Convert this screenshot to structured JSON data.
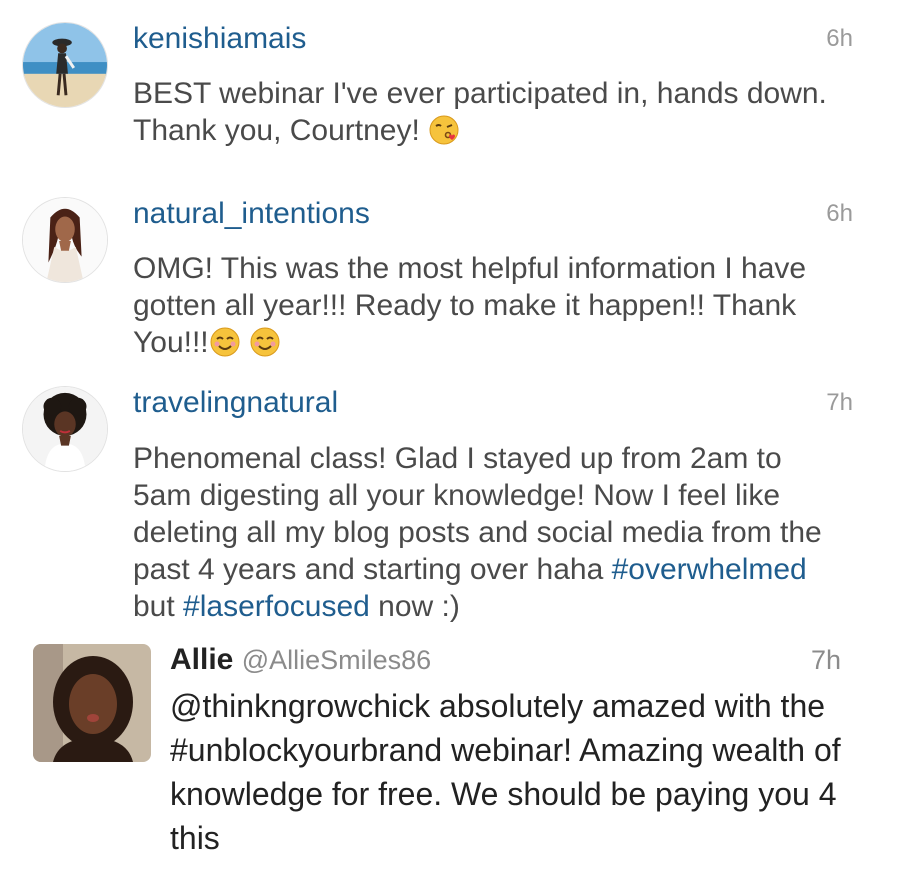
{
  "comments": [
    {
      "username": "kenishiamais",
      "time": "6h",
      "text": "BEST webinar I've ever participated in, hands down. Thank you, Courtney!",
      "emoji": "kissing-heart-emoji"
    },
    {
      "username": "natural_intentions",
      "time": "6h",
      "text": "OMG! This was the most helpful information I have gotten all year!!! Ready to make it happen!! Thank You!!!",
      "emoji": "smiling-face-emoji"
    },
    {
      "username": "travelingnatural",
      "time": "7h",
      "text_before": "Phenomenal class! Glad I stayed up from 2am to 5am digesting all your knowledge! Now I feel like deleting all my blog posts and social media from the past 4 years and starting over haha ",
      "hashtag1": "#overwhelmed",
      "text_mid": " but ",
      "hashtag2": "#laserfocused",
      "text_after": " now :)"
    }
  ],
  "tweet": {
    "name": "Allie",
    "handle": "@AllieSmiles86",
    "time": "7h",
    "text": "@thinkngrowchick  absolutely amazed with the #unblockyourbrand webinar! Amazing wealth of knowledge for free. We should be paying you 4 this"
  },
  "colors": {
    "username": "#1f5d8e",
    "body_text": "#4a4a4a",
    "timestamp": "#9a9a9a"
  }
}
